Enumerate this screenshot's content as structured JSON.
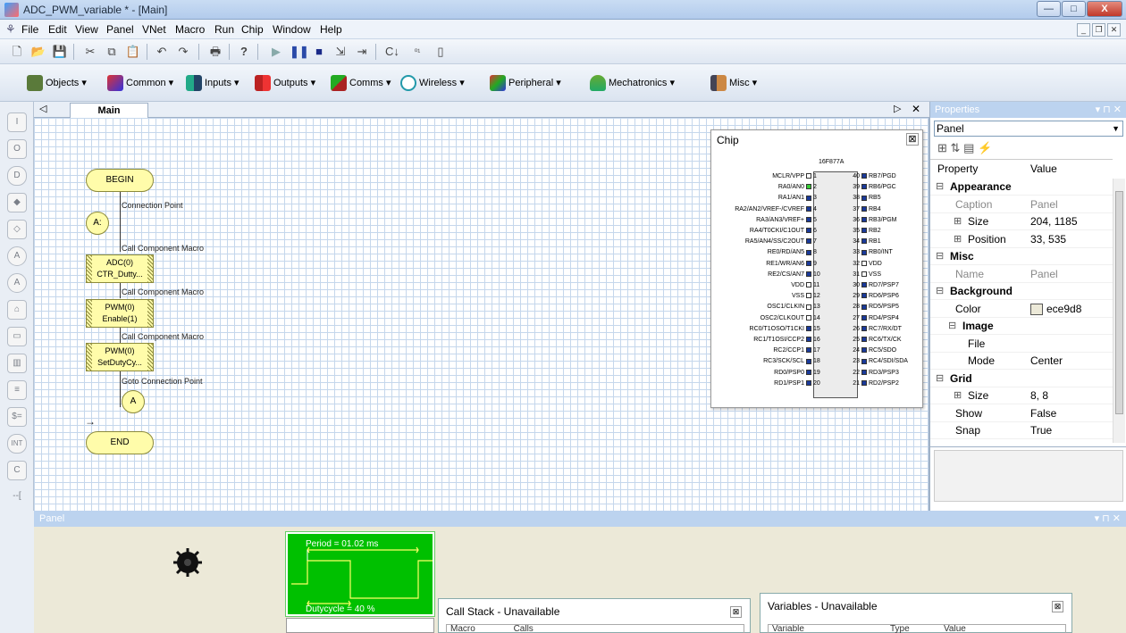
{
  "window": {
    "title": "ADC_PWM_variable * - [Main]",
    "minimize": "—",
    "maximize": "□",
    "close": "X"
  },
  "menu": {
    "items": [
      "File",
      "Edit",
      "View",
      "Panel",
      "VNet",
      "Macro",
      "Run",
      "Chip",
      "Window",
      "Help"
    ],
    "icon": "lamp-icon"
  },
  "toolbar2": {
    "objects": "Objects",
    "common": "Common",
    "inputs": "Inputs",
    "outputs": "Outputs",
    "comms": "Comms",
    "wireless": "Wireless",
    "peripheral": "Peripheral",
    "mechatronics": "Mechatronics",
    "misc": "Misc"
  },
  "editor": {
    "tab": "Main",
    "back": "◁",
    "nav_right": "▷",
    "close": "✕"
  },
  "flowchart": {
    "begin": "BEGIN",
    "end": "END",
    "cp_a1": "A:",
    "cp_label1": "Connection Point",
    "macro1_label": "Call Component Macro",
    "macro1_line1": "ADC(0)",
    "macro1_line2": "CTR_Dutty...",
    "macro2_label": "Call Component Macro",
    "macro2_line1": "PWM(0)",
    "macro2_line2": "Enable(1)",
    "macro3_label": "Call Component Macro",
    "macro3_line1": "PWM(0)",
    "macro3_line2": "SetDutyCy...",
    "goto_label": "Goto Connection Point",
    "goto_a": "A",
    "arrow": "→"
  },
  "chip": {
    "title": "Chip",
    "close": "⊠",
    "model": "16F877A",
    "left_pins": [
      "MCLR/VPP",
      "RA0/AN0",
      "RA1/AN1",
      "RA2/AN2/VREF-/CVREF",
      "RA3/AN3/VREF+",
      "RA4/T0CKI/C1OUT",
      "RA5/AN4/SS/C2OUT",
      "RE0/RD/AN5",
      "RE1/WR/AN6",
      "RE2/CS/AN7",
      "VDD",
      "VSS",
      "OSC1/CLKIN",
      "OSC2/CLKOUT",
      "RC0/T1OSO/T1CKI",
      "RC1/T1OSI/CCP2",
      "RC2/CCP1",
      "RC3/SCK/SCL",
      "RD0/PSP0",
      "RD1/PSP1"
    ],
    "left_nums": [
      "1",
      "2",
      "3",
      "4",
      "5",
      "6",
      "7",
      "8",
      "9",
      "10",
      "11",
      "12",
      "13",
      "14",
      "15",
      "16",
      "17",
      "18",
      "19",
      "20"
    ],
    "right_pins": [
      "RB7/PGD",
      "RB6/PGC",
      "RB5",
      "RB4",
      "RB3/PGM",
      "RB2",
      "RB1",
      "RB0/INT",
      "VDD",
      "VSS",
      "RD7/PSP7",
      "RD6/PSP6",
      "RD5/PSP5",
      "RD4/PSP4",
      "RC7/RX/DT",
      "RC6/TX/CK",
      "RC5/SDO",
      "RC4/SDI/SDA",
      "RD3/PSP3",
      "RD2/PSP2"
    ],
    "right_nums": [
      "40",
      "39",
      "38",
      "37",
      "36",
      "35",
      "34",
      "33",
      "32",
      "31",
      "30",
      "29",
      "28",
      "27",
      "26",
      "25",
      "24",
      "23",
      "22",
      "21"
    ]
  },
  "properties": {
    "title": "Properties",
    "selected": "Panel",
    "col_property": "Property",
    "col_value": "Value",
    "rows": [
      {
        "name": "Appearance",
        "value": "",
        "kind": "group",
        "expander": "⊟"
      },
      {
        "name": "Caption",
        "value": "Panel",
        "kind": "dim"
      },
      {
        "name": "Size",
        "value": "204, 1185",
        "kind": "sub",
        "expander": "⊞"
      },
      {
        "name": "Position",
        "value": "33, 535",
        "kind": "sub",
        "expander": "⊞"
      },
      {
        "name": "Misc",
        "value": "",
        "kind": "group",
        "expander": "⊟"
      },
      {
        "name": "Name",
        "value": "Panel",
        "kind": "dim"
      },
      {
        "name": "Background",
        "value": "",
        "kind": "group",
        "expander": "⊟"
      },
      {
        "name": "Color",
        "value": "ece9d8",
        "kind": "color"
      },
      {
        "name": "Image",
        "value": "",
        "kind": "subgroup",
        "expander": "⊟"
      },
      {
        "name": "File",
        "value": "",
        "kind": "deep"
      },
      {
        "name": "Mode",
        "value": "Center",
        "kind": "deep"
      },
      {
        "name": "Grid",
        "value": "",
        "kind": "group",
        "expander": "⊟"
      },
      {
        "name": "Size",
        "value": "8, 8",
        "kind": "sub",
        "expander": "⊞"
      },
      {
        "name": "Show",
        "value": "False",
        "kind": "plain"
      },
      {
        "name": "Snap",
        "value": "True",
        "kind": "plain"
      }
    ],
    "pin": "▾ ⊓ ✕"
  },
  "panel": {
    "title": "Panel",
    "pin": "▾ ⊓ ✕",
    "scope_period": "Period = 01.02 ms",
    "scope_duty": "Dutycycle = 40 %",
    "callstack_title": "Call Stack - Unavailable",
    "callstack_col1": "Macro",
    "callstack_col2": "Calls",
    "variables_title": "Variables - Unavailable",
    "var_col1": "Variable",
    "var_col2": "Type",
    "var_col3": "Value",
    "close": "⊠"
  },
  "colors": {
    "accent": "#bcd3ef",
    "panel_bg": "#ece9d8",
    "scope_bg": "#00c000"
  }
}
